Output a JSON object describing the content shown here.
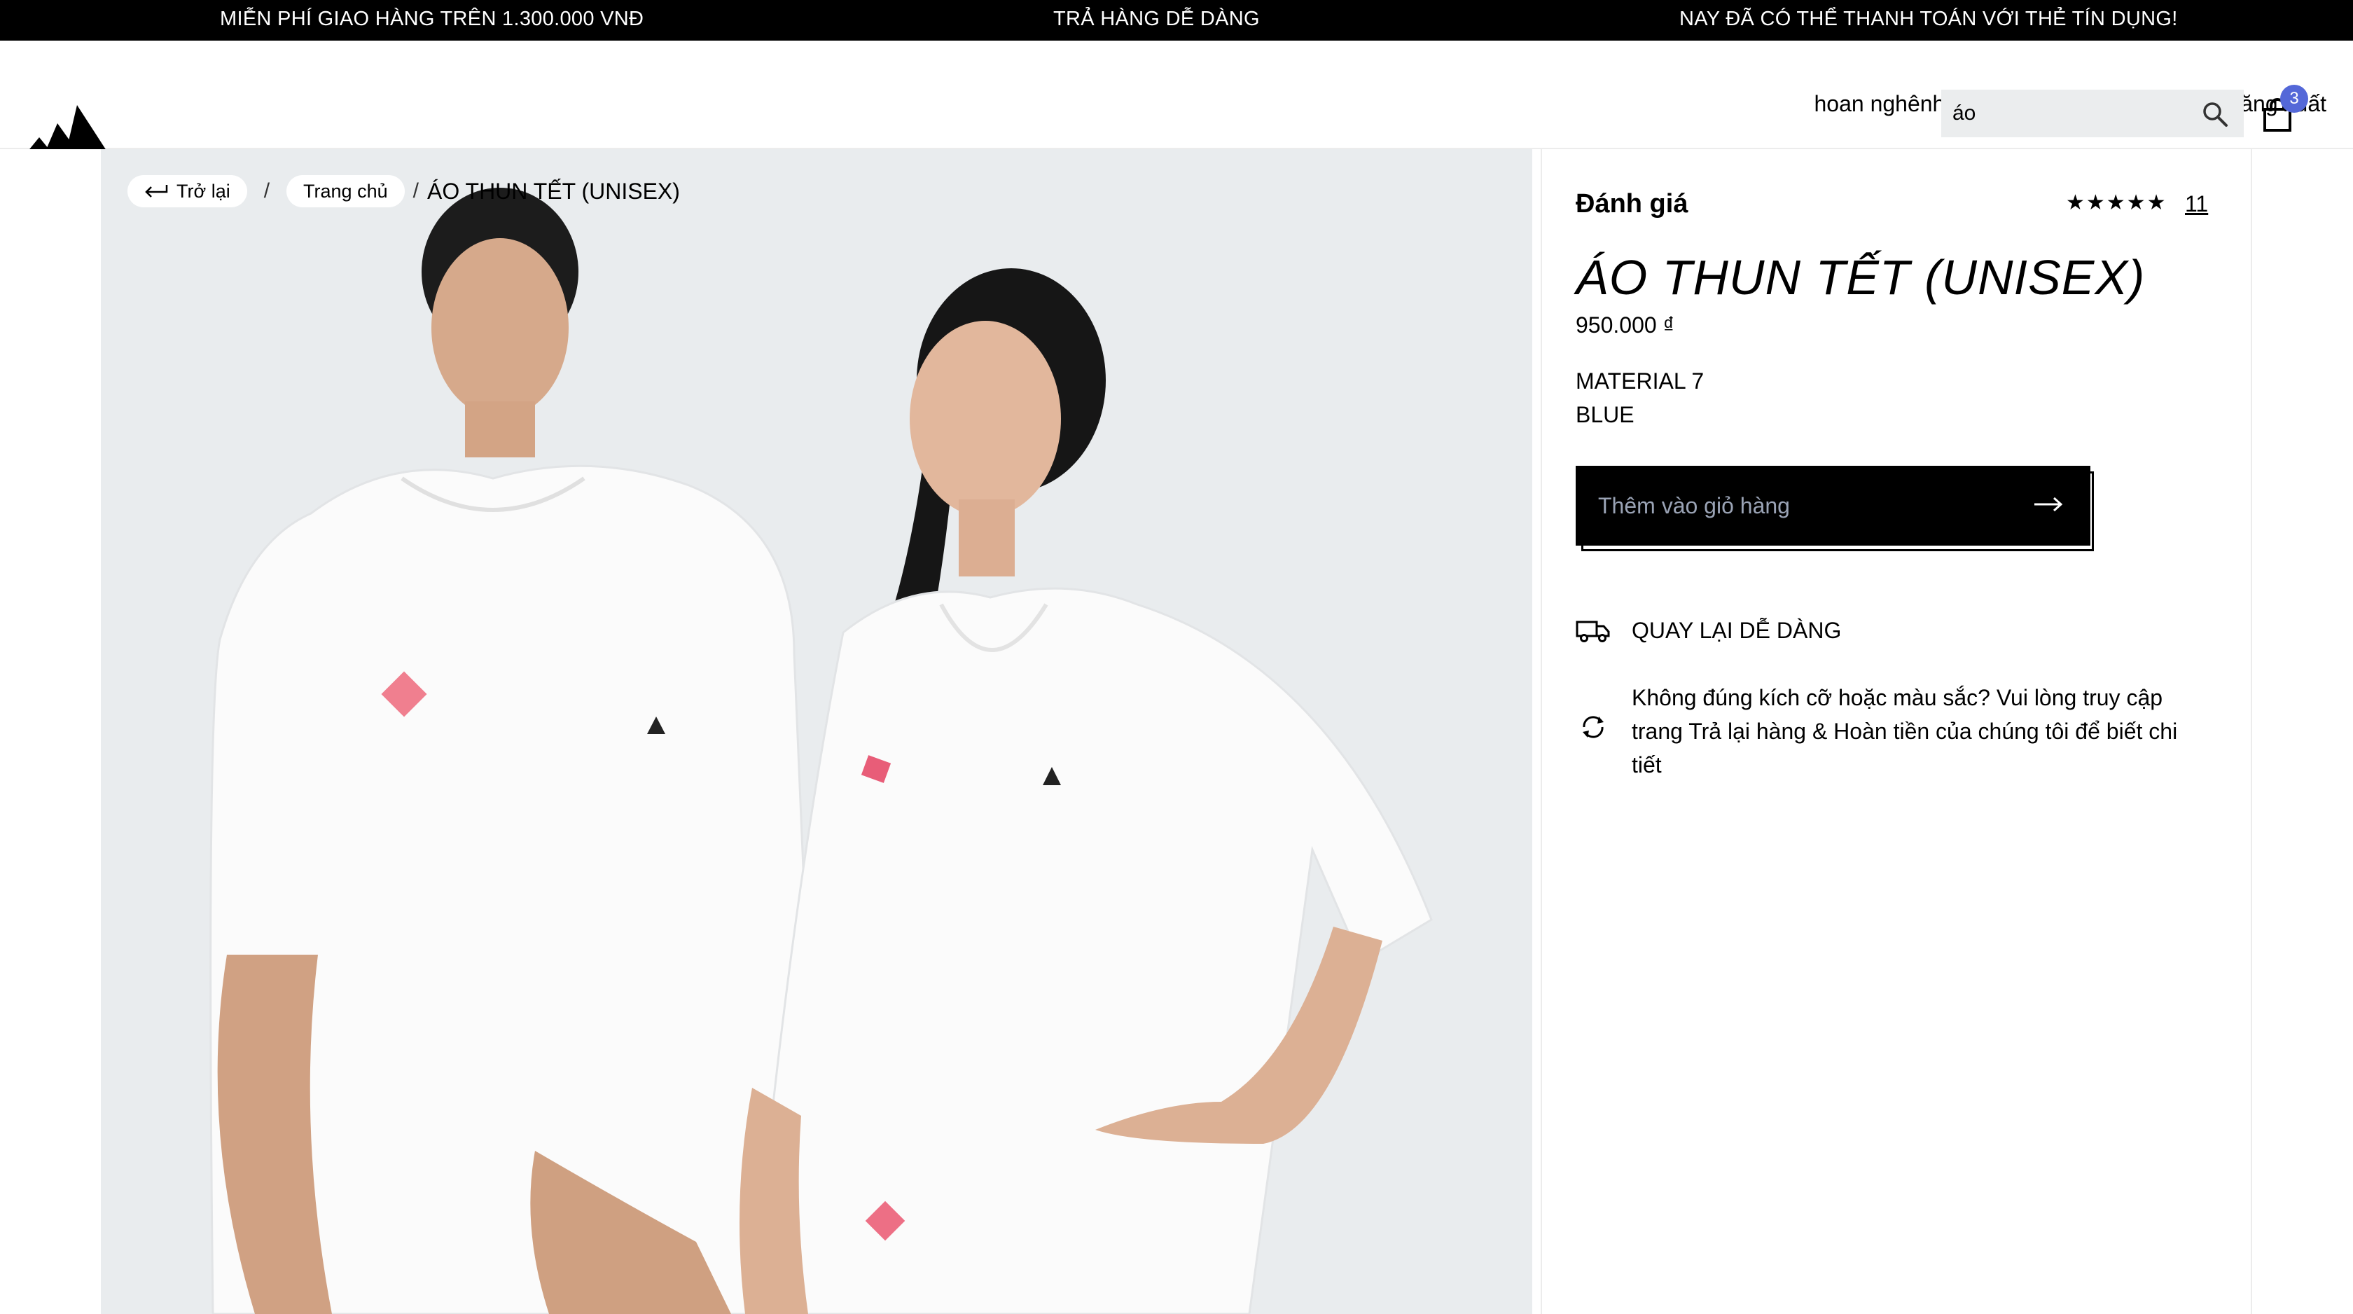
{
  "announcement_bar": {
    "left": "MIỄN PHÍ GIAO HÀNG TRÊN 1.300.000 VNĐ",
    "center": "TRẢ HÀNG DỄ DÀNG",
    "right": "NAY ĐÃ CÓ THỂ THANH TOÁN VỚI THẺ TÍN DỤNG!"
  },
  "header": {
    "logo_icon": "adidas-logo-icon",
    "welcome_text": "hoan nghênh bạn trở lại admin",
    "logout_label": "đăng xuất",
    "search": {
      "value": "áo",
      "icon": "search-icon"
    },
    "cart": {
      "icon": "shopping-bag-icon",
      "count": "3"
    }
  },
  "breadcrumb": {
    "back_label": "Trở lại",
    "home_label": "Trang chủ",
    "current": "ÁO THUN TẾT (UNISEX)"
  },
  "product": {
    "rating_label": "Đánh giá",
    "stars": "★★★★★",
    "rating_count": "11",
    "name": "ÁO THUN TẾT (UNISEX)",
    "price": "950.000 ₫",
    "material": "MATERIAL 7",
    "color": "BLUE",
    "add_to_cart_label": "Thêm vào giỏ hàng"
  },
  "features": [
    {
      "icon": "delivery-truck-icon",
      "text": "QUAY LẠI DỄ DÀNG"
    },
    {
      "icon": "refresh-icon",
      "text": "Không đúng kích cỡ hoặc màu sắc? Vui lòng truy cập trang Trả lại hàng & Hoàn tiền của chúng tôi để biết chi tiết"
    }
  ],
  "colors": {
    "announcement_bg": "#000000",
    "image_bg": "#e9ecee",
    "cart_badge": "#5468d8",
    "button_bg": "#000000"
  }
}
